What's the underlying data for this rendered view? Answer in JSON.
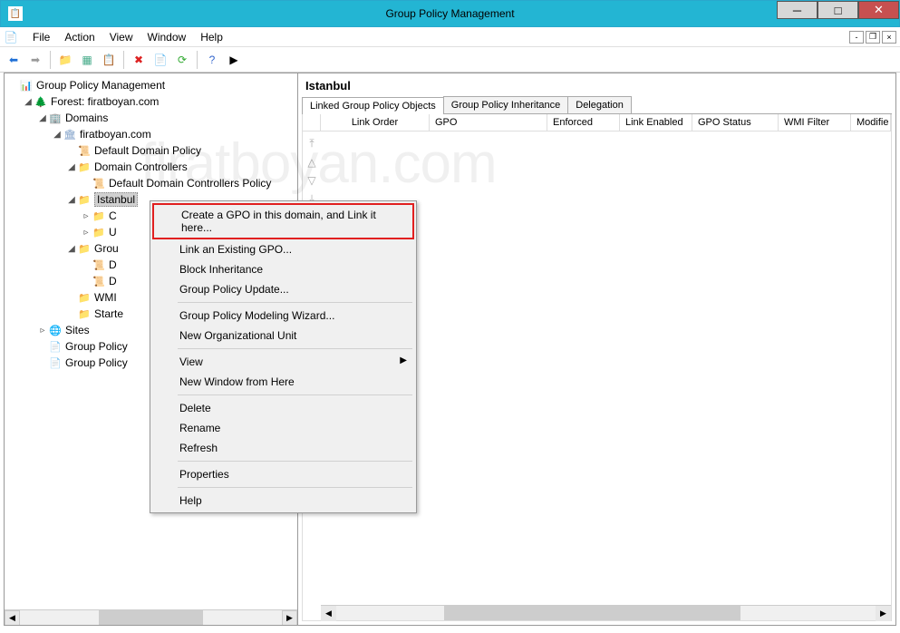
{
  "window": {
    "title": "Group Policy Management"
  },
  "menubar": {
    "file": "File",
    "action": "Action",
    "view": "View",
    "window": "Window",
    "help": "Help"
  },
  "tree": {
    "root": "Group Policy Management",
    "forest": "Forest: firatboyan.com",
    "domains": "Domains",
    "domain": "firatboyan.com",
    "default_policy": "Default Domain Policy",
    "domain_controllers": "Domain Controllers",
    "default_dc_policy": "Default Domain Controllers Policy",
    "istanbul": "Istanbul",
    "istanbul_child_c": "C",
    "istanbul_child_u": "U",
    "group_policy_objects": "Grou",
    "gpo_d1": "D",
    "gpo_d2": "D",
    "wmi_filters": "WMI",
    "starter_gpos": "Starte",
    "sites": "Sites",
    "gp_modeling": "Group Policy",
    "gp_results": "Group Policy"
  },
  "right": {
    "heading": "Istanbul",
    "tabs": {
      "linked": "Linked Group Policy Objects",
      "inheritance": "Group Policy Inheritance",
      "delegation": "Delegation"
    },
    "columns": {
      "link_order": "Link Order",
      "gpo": "GPO",
      "enforced": "Enforced",
      "link_enabled": "Link Enabled",
      "gpo_status": "GPO Status",
      "wmi_filter": "WMI Filter",
      "modified": "Modifie"
    }
  },
  "context_menu": {
    "create_link": "Create a GPO in this domain, and Link it here...",
    "link_existing": "Link an Existing GPO...",
    "block_inheritance": "Block Inheritance",
    "gp_update": "Group Policy Update...",
    "gp_modeling_wizard": "Group Policy Modeling Wizard...",
    "new_ou": "New Organizational Unit",
    "view": "View",
    "new_window": "New Window from Here",
    "delete": "Delete",
    "rename": "Rename",
    "refresh": "Refresh",
    "properties": "Properties",
    "help": "Help"
  },
  "watermark": "firatboyan.com"
}
